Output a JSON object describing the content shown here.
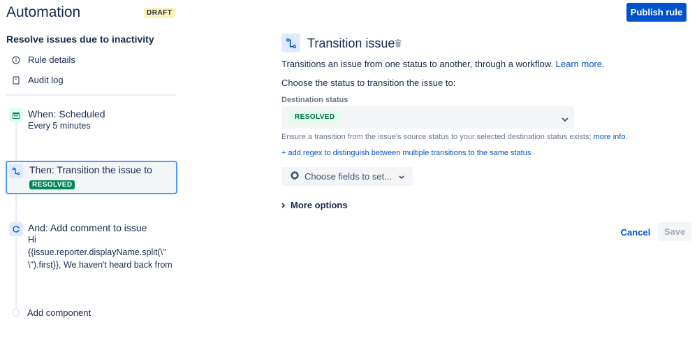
{
  "header": {
    "app_title": "Automation",
    "draft_badge": "DRAFT",
    "publish_label": "Publish rule"
  },
  "sidebar": {
    "rule_name": "Resolve issues due to inactivity",
    "nav": [
      {
        "label": "Rule details",
        "icon": "info-icon"
      },
      {
        "label": "Audit log",
        "icon": "document-icon"
      }
    ],
    "steps": [
      {
        "title": "When: Scheduled",
        "subtitle": "Every 5 minutes",
        "icon": "calendar-icon"
      },
      {
        "title": "Then: Transition the issue to",
        "badge": "RESOLVED",
        "icon": "transition-icon"
      },
      {
        "title": "And: Add comment to issue",
        "lines": [
          "Hi",
          "{{issue.reporter.displayName.split(\\\"",
          "\\\").first}}, We haven't heard back from"
        ],
        "icon": "comment-icon"
      }
    ],
    "add_component": "Add component"
  },
  "main": {
    "title": "Transition issue",
    "description": "Transitions an issue from one status to another, through a workflow.",
    "learn_more": "Learn more.",
    "prompt": "Choose the status to transition the issue to:",
    "field_label": "Destination status",
    "selected_status": "RESOLVED",
    "helper": "Ensure a transition from the issue's source status to your selected destination status exists;",
    "more_info": "more info.",
    "regex_link": "+ add regex to distinguish between multiple transitions to the same status",
    "choose_fields": "Choose fields to set...",
    "more_options": "More options",
    "cancel": "Cancel",
    "save": "Save"
  },
  "colors": {
    "primary": "#0052cc",
    "success": "#00875a",
    "draft": "#fff0b3"
  }
}
